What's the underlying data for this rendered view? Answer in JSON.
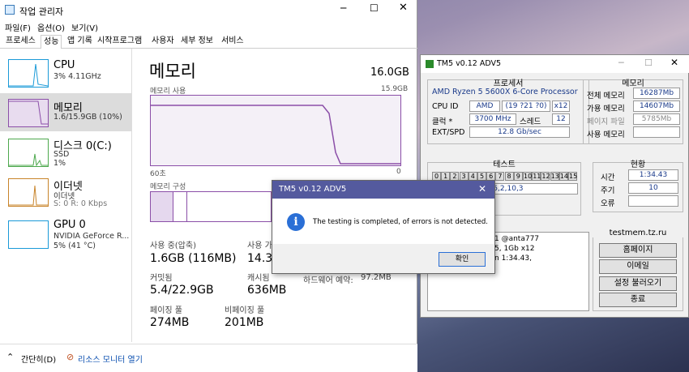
{
  "taskmgr": {
    "title": "작업 관리자",
    "menu": [
      "파일(F)",
      "옵션(O)",
      "보기(V)"
    ],
    "tabs": [
      "프로세스",
      "성능",
      "앱 기록",
      "시작프로그램",
      "사용자",
      "세부 정보",
      "서비스"
    ],
    "sidebar": [
      {
        "name": "CPU",
        "sub1": "3% 4.11GHz",
        "sub2": ""
      },
      {
        "name": "메모리",
        "sub1": "1.6/15.9GB (10%)",
        "sub2": ""
      },
      {
        "name": "디스크 0(C:)",
        "sub1": "SSD",
        "sub2": "1%"
      },
      {
        "name": "이더넷",
        "sub1": "이더넷",
        "sub2": "S: 0 R: 0 Kbps"
      },
      {
        "name": "GPU 0",
        "sub1": "NVIDIA GeForce R...",
        "sub2": "5% (41 °C)"
      }
    ],
    "heading": "메모리",
    "total": "16.0GB",
    "usage_label": "메모리 사용",
    "usage_max": "15.9GB",
    "time_left": "60초",
    "time_right": "0",
    "composition_label": "메모리 구성",
    "stats": {
      "in_use_label": "사용 중(압축)",
      "in_use": "1.6GB (116MB)",
      "avail_label": "사용 가",
      "avail": "14.3",
      "committed_label": "커밋됨",
      "committed": "5.4/22.9GB",
      "cached_label": "캐시됨",
      "cached": "636MB",
      "hw_label": "하드웨어 예약:",
      "hw": "97.2MB",
      "paged_label": "페이징 풀",
      "paged": "274MB",
      "nonpaged_label": "비페이징 풀",
      "nonpaged": "201MB"
    },
    "footer": {
      "less": "간단히(D)",
      "monitor": "리소스 모니터 열기"
    }
  },
  "tm5": {
    "title": "TM5 v0.12 ADV5",
    "proc_title": "프로세서",
    "proc": "AMD Ryzen 5 5600X 6-Core Processor",
    "cpuid_label": "CPU ID",
    "cpuid_vendor": "AMD",
    "cpuid": "(19 ?21 ?0)",
    "threads_x": "x12",
    "clock_label": "클럭 *",
    "clock": "3700 MHz",
    "thread_label": "스레드",
    "thread": "12",
    "ext_label": "EXT/SPD",
    "ext": "12.8 Gb/sec",
    "mem_title": "메모리",
    "total_label": "전체 메모리",
    "total": "16287Mb",
    "avail_label": "가용 메모리",
    "avail": "14607Mb",
    "page_label": "페이지 파일",
    "page": "5785Mb",
    "used_label": "사용 메모리",
    "used": "",
    "test_title": "테스트",
    "cells": [
      "0",
      "1",
      "2",
      "3",
      "4",
      "5",
      "6",
      "7",
      "8",
      "9",
      "10",
      "11",
      "12",
      "13",
      "14",
      "15"
    ],
    "seq": "1,15,2,10,3",
    "status_title": "현황",
    "time_label": "시간",
    "time": "1:34.43",
    "cycle_label": "주기",
    "cycle": "10",
    "err_label": "오류",
    "err": "",
    "log": [
      "1 @anta777",
      "5, 1Gb x12",
      "n 1:34.43,"
    ],
    "site": "testmem.tz.ru",
    "btns": [
      "홈페이지",
      "이메일",
      "설정 불러오기",
      "종료"
    ]
  },
  "dialog": {
    "title": "TM5 v0.12 ADV5",
    "message": "The testing is completed, of errors is not detected.",
    "ok": "확인"
  }
}
